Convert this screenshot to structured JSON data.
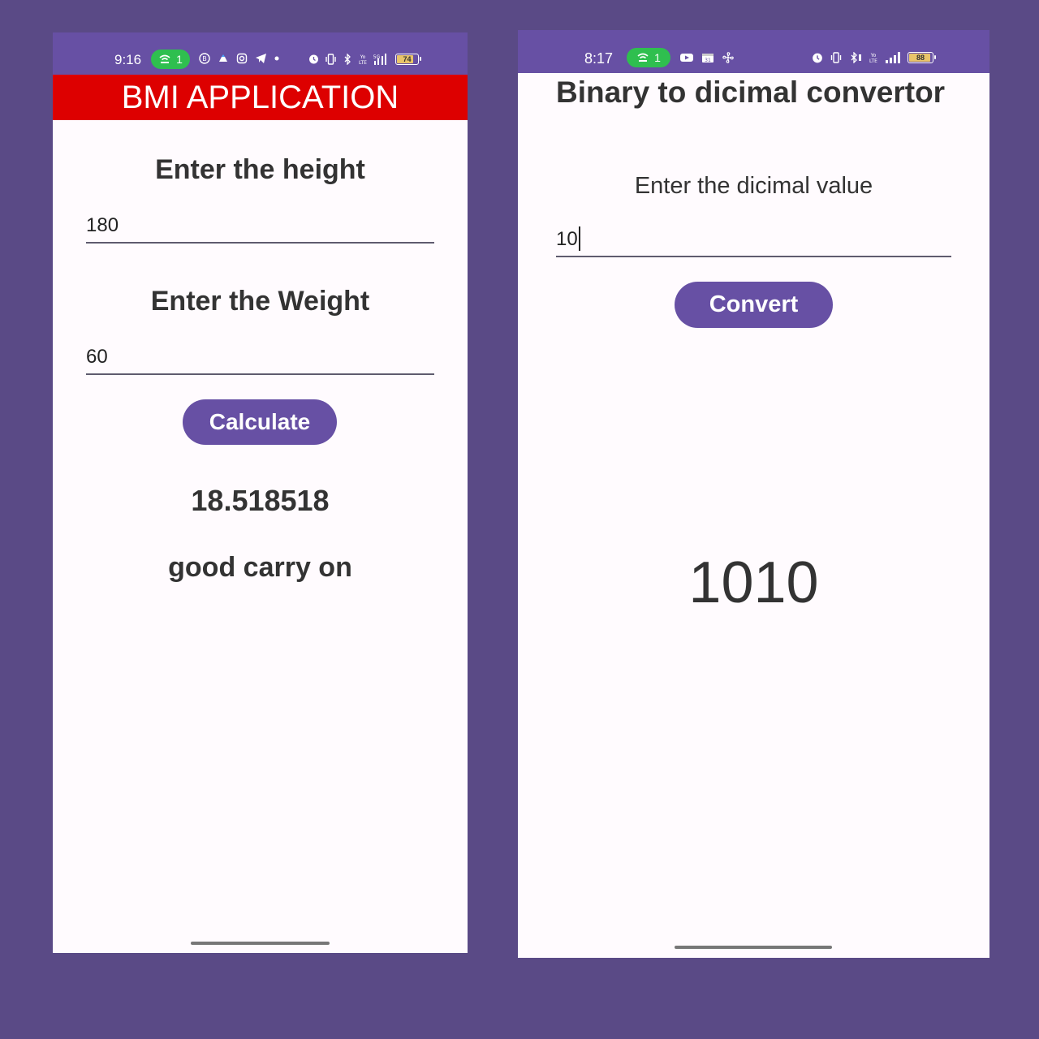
{
  "left_phone": {
    "status": {
      "time": "9:16",
      "pill_count": "1",
      "battery": "74"
    },
    "app_title": "BMI APPLICATION",
    "height_label": "Enter the height",
    "height_value": "180",
    "weight_label": "Enter the Weight",
    "weight_value": "60",
    "calculate_label": "Calculate",
    "bmi_result": "18.518518",
    "bmi_message": "good carry on"
  },
  "right_phone": {
    "status": {
      "time": "8:17",
      "pill_count": "1",
      "battery": "88"
    },
    "app_title": "Binary to dicimal convertor",
    "input_label": "Enter the dicimal value",
    "input_value": "10",
    "convert_label": "Convert",
    "binary_result": "1010"
  },
  "colors": {
    "background": "#5a4a86",
    "statusbar": "#6750a4",
    "appbar_red": "#dd0000",
    "button": "#6750a4",
    "call_pill": "#2fbf4f"
  },
  "icons": {
    "status_left": [
      "hotspot-icon",
      "b-app-icon",
      "drive-icon",
      "instagram-icon",
      "telegram-icon",
      "dot-icon",
      "alarm-icon",
      "vibrate-icon",
      "bluetooth-icon",
      "volte-icon",
      "signal-5g-icon",
      "battery-icon"
    ],
    "status_right": [
      "hotspot-icon",
      "youtube-icon",
      "calendar-icon",
      "fan-icon",
      "alarm-icon",
      "vibrate-icon",
      "bluetooth-icon",
      "volte-icon",
      "signal-icon",
      "battery-icon"
    ]
  }
}
